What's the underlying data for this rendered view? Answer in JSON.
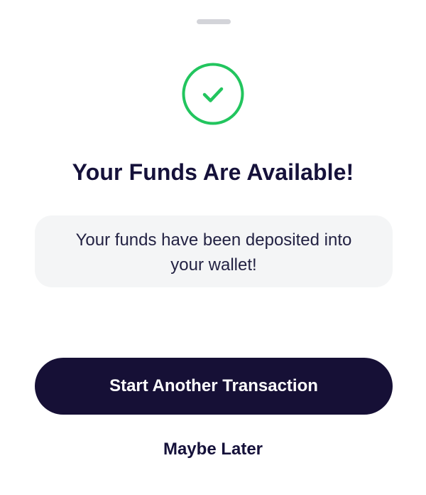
{
  "sheet": {
    "title": "Your Funds Are Available!",
    "message": "Your funds have been deposited into your wallet!",
    "primary_action_label": "Start Another Transaction",
    "secondary_action_label": "Maybe Later",
    "status_icon": "check-circle-icon"
  },
  "colors": {
    "success": "#22c55e",
    "text_dark": "#15113a",
    "button_bg": "#161036",
    "message_bg": "#f4f5f6",
    "handle": "#d3d4d9"
  }
}
